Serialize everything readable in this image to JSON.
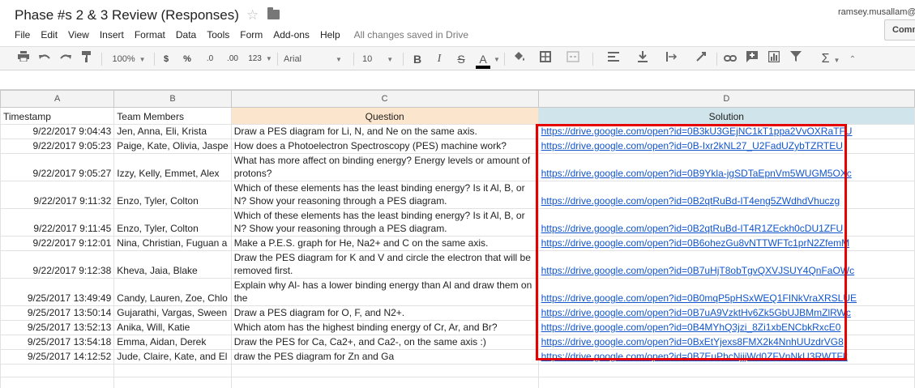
{
  "title": "Phase #s 2 & 3 Review  (Responses)",
  "user": "ramsey.musallam@",
  "comments_label": "Comm",
  "menu": [
    "File",
    "Edit",
    "View",
    "Insert",
    "Format",
    "Data",
    "Tools",
    "Form",
    "Add-ons",
    "Help"
  ],
  "save_status": "All changes saved in Drive",
  "toolbar": {
    "zoom": "100%",
    "currency": "$",
    "percent": "%",
    "decrease_decimal": ".0",
    "increase_decimal": ".00",
    "more_formats": "123",
    "font": "Arial",
    "font_size": "10",
    "bold": "B",
    "italic": "I",
    "strike": "S",
    "text_color": "A"
  },
  "columns": [
    "A",
    "B",
    "C",
    "D"
  ],
  "headers": {
    "timestamp": "Timestamp",
    "team": "Team Members",
    "question": "Question",
    "solution": "Solution"
  },
  "colors": {
    "question_header": "#fce5cd",
    "solution_header": "#d0e4ec",
    "link": "#1155cc",
    "highlight": "#e60000"
  },
  "rows": [
    {
      "timestamp": "9/22/2017 9:04:43",
      "team": "Jen, Anna, Eli, Krista",
      "question": "Draw a PES diagram for Li, N, and Ne on the same axis.",
      "solution": "https://drive.google.com/open?id=0B3kU3GEjNC1kT1ppa2VvOXRaTFU"
    },
    {
      "timestamp": "9/22/2017 9:05:23",
      "team": "Paige, Kate, Olivia, Jaspe",
      "question": "How does a Photoelectron Spectroscopy (PES) machine work?",
      "solution": "https://drive.google.com/open?id=0B-Ixr2kNL27_U2FadUZybTZRTEU"
    },
    {
      "timestamp": "9/22/2017 9:05:27",
      "team": "Izzy, Kelly, Emmet, Alex",
      "question": "What has more affect on binding energy? Energy levels or amount of protons?",
      "solution": "https://drive.google.com/open?id=0B9Ykla-jgSDTaEpnVm5WUGM5OXc"
    },
    {
      "timestamp": "9/22/2017 9:11:32",
      "team": "Enzo, Tyler, Colton",
      "question": "Which of these elements has the least binding energy? Is it Al, B, or N? Show your reasoning through a PES diagram.",
      "solution": "https://drive.google.com/open?id=0B2qtRuBd-IT4eng5ZWdhdVhuczg"
    },
    {
      "timestamp": "9/22/2017 9:11:45",
      "team": "Enzo, Tyler, Colton",
      "question": "Which of these elements has the least binding energy? Is it Al, B, or N? Show your reasoning through a PES diagram.",
      "solution": "https://drive.google.com/open?id=0B2qtRuBd-IT4R1ZEckh0cDU1ZFU"
    },
    {
      "timestamp": "9/22/2017 9:12:01",
      "team": "Nina, Christian, Fuguan a",
      "question": "Make a P.E.S. graph for He, Na2+ and C on the same axis.",
      "solution": "https://drive.google.com/open?id=0B6ohezGu8vNTTWFTc1prN2ZfemM"
    },
    {
      "timestamp": "9/22/2017 9:12:38",
      "team": "Kheva, Jaia, Blake",
      "question": "Draw the PES diagram for K and V and circle the electron that will be removed first.",
      "solution": "https://drive.google.com/open?id=0B7uHjT8obTgvQXVJSUY4QnFaOWc"
    },
    {
      "timestamp": "9/25/2017 13:49:49",
      "team": "Candy, Lauren, Zoe, Chlo",
      "question": "Explain why Al- has a lower binding energy than Al and draw them on the",
      "solution": "https://drive.google.com/open?id=0B0mqP5pHSxWEQ1FINkVraXRSLUE"
    },
    {
      "timestamp": "9/25/2017 13:50:14",
      "team": "Gujarathi, Vargas, Sween",
      "question": "Draw a PES diagram for O, F, and N2+.",
      "solution": "https://drive.google.com/open?id=0B7uA9VzktHv6Zk5GbUJBMmZlRWc"
    },
    {
      "timestamp": "9/25/2017 13:52:13",
      "team": "Anika, Will, Katie",
      "question": "Which atom has the highest binding energy of Cr, Ar, and Br?",
      "solution": "https://drive.google.com/open?id=0B4MYhQ3jzi_8Zi1xbENCbkRxcE0"
    },
    {
      "timestamp": "9/25/2017 13:54:18",
      "team": "Emma, Aidan, Derek",
      "question": "Draw the PES for Ca, Ca2+, and Ca2-, on the same axis :)",
      "solution": "https://drive.google.com/open?id=0BxEtYjexs8FMX2k4NnhUUzdrVG8"
    },
    {
      "timestamp": "9/25/2017 14:12:52",
      "team": "Jude, Claire, Kate, and El",
      "question": "draw the PES diagram for Zn and Ga",
      "solution": "https://drive.google.com/open?id=0B7EuPhcNjjjWd0ZFVnNkU3RWTFk"
    }
  ]
}
